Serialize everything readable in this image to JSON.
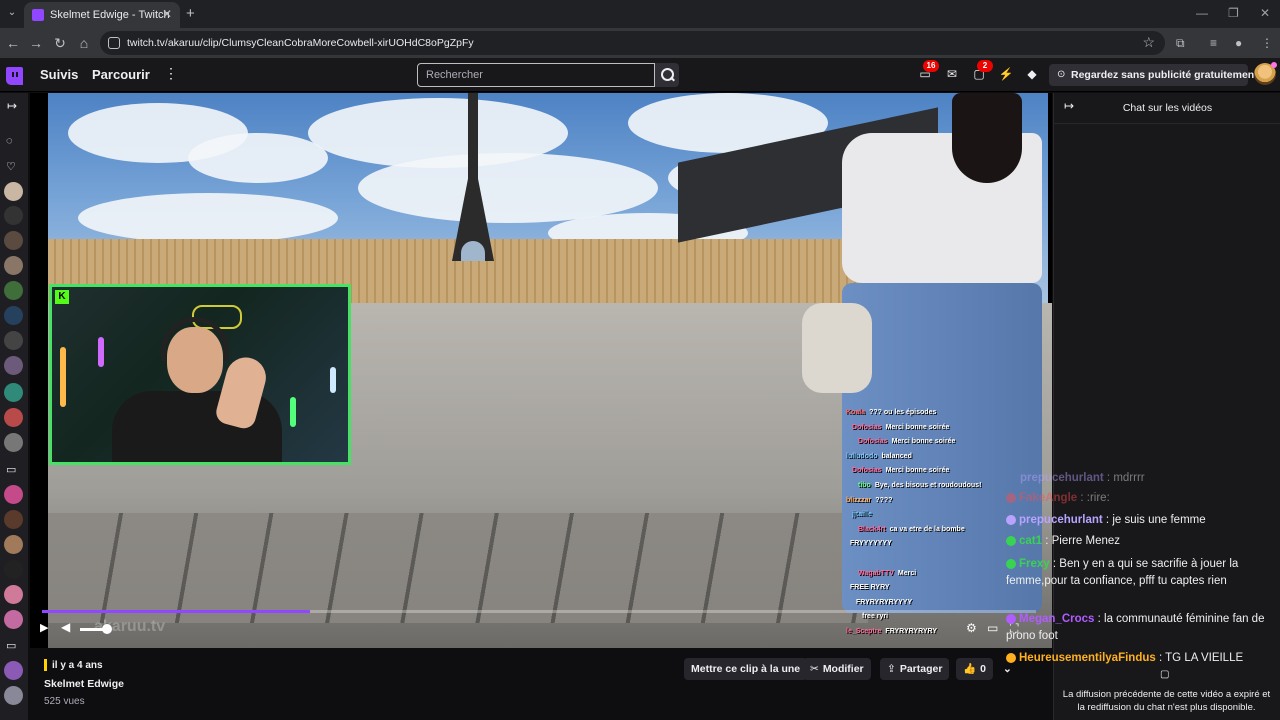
{
  "browser": {
    "tab_title": "Skelmet Edwige - Twitch",
    "url": "twitch.tv/akaruu/clip/ClumsyCleanCobraMoreCowbell-xirUOHdC8oPgZpFy"
  },
  "nav": {
    "following": "Suivis",
    "browse": "Parcourir",
    "search_placeholder": "Rechercher",
    "badge_inventory": "16",
    "badge_notifications": "2",
    "adfree_label": "Regardez sans publicité gratuitement"
  },
  "player": {
    "watermark": "akaruu.tv",
    "progress": 0.27,
    "volume": 0.9,
    "webcam_logo": "K",
    "overlay_chat": [
      {
        "user": "Koala",
        "text": "??? ou les épisodes",
        "color": "#ff6b6b"
      },
      {
        "user": "Dofosias",
        "text": "Merci bonne soirée",
        "color": "#ff6b9a"
      },
      {
        "user": "Dofosias",
        "text": "Merci bonne soirée",
        "color": "#ff6b9a"
      },
      {
        "user": "lulludodo",
        "text": "balanced",
        "color": "#7ec8ff"
      },
      {
        "user": "Dofosias",
        "text": "Merci bonne soirée",
        "color": "#ff6b9a"
      },
      {
        "user": "tibo",
        "text": "Bye, des bisous et roudoudous!",
        "color": "#6bff8f"
      },
      {
        "user": "blizzzar",
        "text": "????",
        "color": "#ffb36b"
      },
      {
        "user": "jjtaille",
        "text": "",
        "color": "#7ec8ff"
      },
      {
        "user": "Black4rt",
        "text": "ca va etre de la bombe",
        "color": "#ff6b9a"
      },
      {
        "user": "",
        "text": "FRYYYYYYY",
        "color": "#7ec8ff"
      },
      {
        "user": "",
        "text": "",
        "color": "#ff6b6b"
      },
      {
        "user": "WagabTTV",
        "text": "Merci",
        "color": "#ff6b9a"
      },
      {
        "user": "",
        "text": "FREE RYRY",
        "color": "#7ec8ff"
      },
      {
        "user": "",
        "text": "FRYRYRYRYYYY",
        "color": "#ff6b6b"
      },
      {
        "user": "",
        "text": "free ryri",
        "color": "#7ec8ff"
      },
      {
        "user": "le_Sceptre",
        "text": "FRYRYRYRYRY",
        "color": "#ff6b9a"
      }
    ]
  },
  "clip": {
    "ago": "il y a 4 ans",
    "title": "Skelmet Edwige",
    "views": "525 vues",
    "actions": {
      "share_clip_moment": "Mettre ce clip à la une",
      "edit": "Modifier",
      "share": "Partager",
      "likes": "0"
    }
  },
  "chat": {
    "heading": "Chat sur les vidéos",
    "messages": [
      {
        "user": "prepucehurlant",
        "sep": " : ",
        "text": "mdrrrr",
        "color": "#b9a3ff",
        "faded": true
      },
      {
        "user": "FakeAngle",
        "sep": " : ",
        "text": ":rire:",
        "color": "#ff4b4b",
        "faded": true
      },
      {
        "user": "prepucehurlant",
        "sep": " : ",
        "text": "je suis une femme",
        "color": "#b9a3ff",
        "faded": false
      },
      {
        "user": "cat1",
        "sep": " : ",
        "text": "Pierre Menez",
        "color": "#39d353",
        "faded": false
      },
      {
        "user": "Frexy",
        "sep": " : ",
        "text": "Ben y en a qui se sacrifie à jouer la femme,pour ta confiance, pfff tu captes rien",
        "color": "#39d353",
        "faded": false
      },
      {
        "user": "Megan_Crocs",
        "sep": " : ",
        "text": "la communauté féminine fan de prono foot",
        "color": "#b15cff",
        "faded": false
      },
      {
        "user": "HeureusementilyaFindus",
        "sep": " : ",
        "text": "TG LA VIEILLE",
        "color": "#ffb020",
        "faded": false
      }
    ],
    "note": "La diffusion précédente de cette vidéo a expiré et la rediffusion du chat n'est plus disponible."
  }
}
